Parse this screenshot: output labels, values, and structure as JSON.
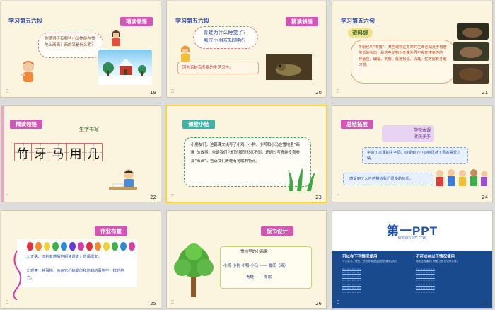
{
  "slides": [
    {
      "number": "19",
      "title": "学习第五六段",
      "tag": "精读领悟",
      "bubble": "你猜得还有哪些小动物能在雪地上画画？画的又是什么呢？"
    },
    {
      "number": "20",
      "title": "学习第五六段",
      "tag": "精读领悟",
      "questions": [
        "青蛙为什么睡觉了？",
        "哪位小朋友知道呢？"
      ],
      "answer": "因为青蛙有冬眠的生活习性。"
    },
    {
      "number": "21",
      "title": "学习第五六句",
      "badge": "资料袋",
      "text": "冬眠也叫“冬蛰”，某些动物在冬季时生命活动处于极度降低的状态，是这些动物对冬季外界不良环境条件的一种适应。蝙蝠、刺猬、极地松鼠、青蛙、蛇等都有冬眠习惯。"
    },
    {
      "number": "22",
      "tag": "精读领悟",
      "heading": "生字书写",
      "chars": [
        "竹",
        "牙",
        "马",
        "用",
        "几"
      ]
    },
    {
      "number": "23",
      "tag": "课堂小结",
      "text": "小朋友们，这篇课文描写了小鸡、小狗、小鸭和小马在雪地里“画画”的故事，告诉我们它们的脚印形状不同，还通过写青蛙没有参加“画画”，告诉我们青蛙有冬眠的特点。"
    },
    {
      "number": "24",
      "tag": "总结拓展",
      "note": "学完本课收获多多",
      "item1": "学会了本课的生字词，感受到了小动物们对下雪的喜爱之情。",
      "item2": "感受到了大自然带给我们很多的快乐。"
    },
    {
      "number": "25",
      "tag": "作业布置",
      "hw1": "1.正确、流利有感情地朗读课文，背诵课文。",
      "hw2": "2.观察一种事物，画画它们的脚印和你到的事物不一样的地方。"
    },
    {
      "number": "26",
      "tag": "板书设计",
      "board_title": "雪地里的小画家",
      "board_line": "小鸡 小狗 小鸭 小马 —— 脚印（画）",
      "board_line2": "青蛙 —— 冬眠"
    },
    {
      "number": "27",
      "logo": "第一PPT",
      "url": "WWW.1PPT.COM",
      "left_head": "可以在下列情况使用",
      "right_head": "不可以在以下情况使用",
      "left_text": "个人学习、研究；任何非商业性目的的演示活动；",
      "right_text": "商业目的演示；网络上传至公开平台；"
    }
  ],
  "icons": {
    "slide_icon": "slide-icon"
  },
  "colors": {
    "tag_pink": "#d256b3",
    "tag_teal": "#3bb6a6",
    "title_blue": "#2f4fa8",
    "slide_bg": "#fbf5df",
    "selected": "#ffd23c"
  }
}
